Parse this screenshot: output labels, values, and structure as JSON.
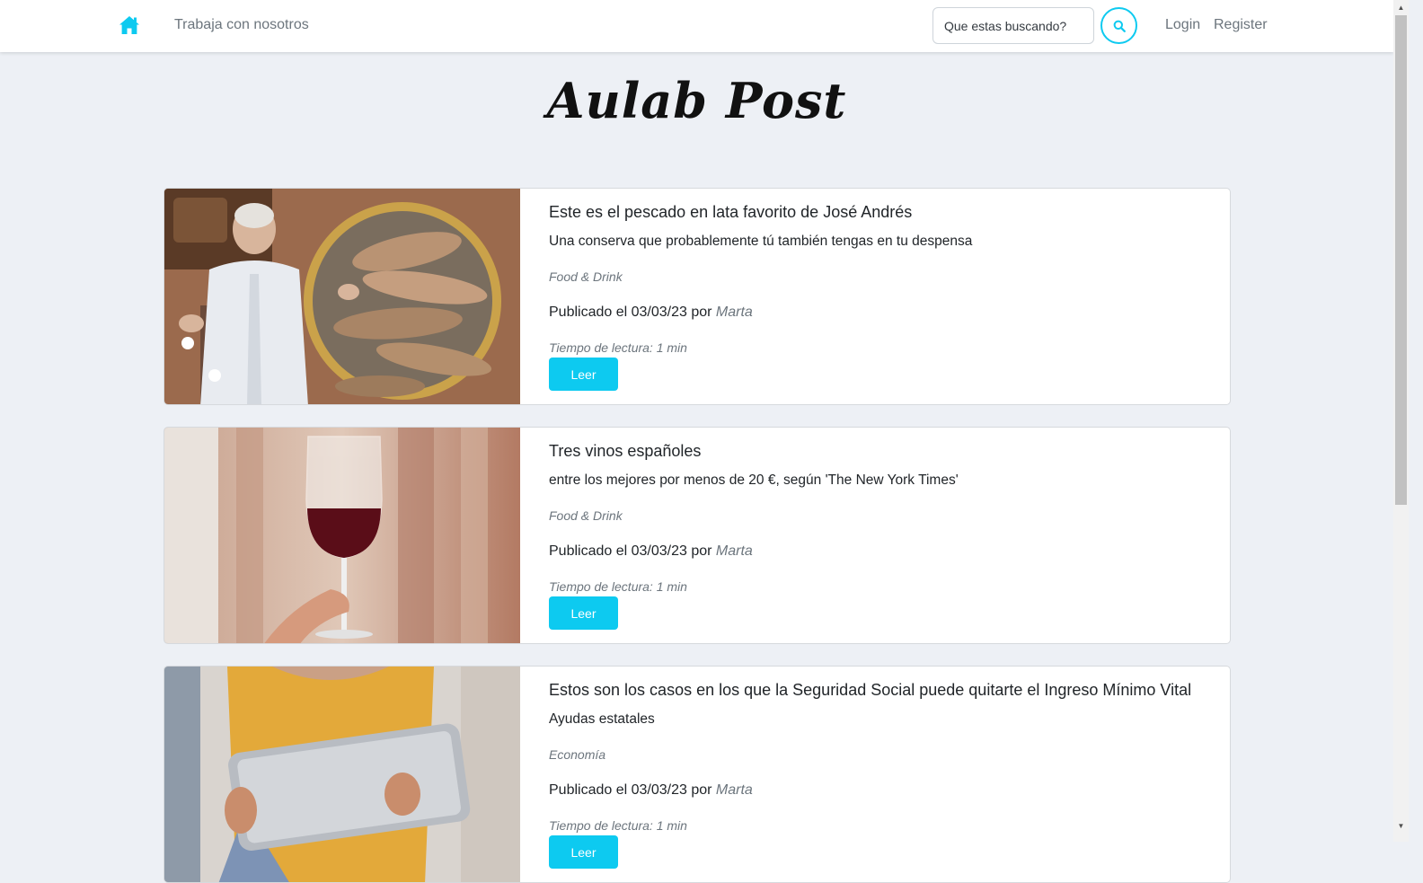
{
  "nav": {
    "home_icon": "home-icon",
    "work_with_us": "Trabaja con nosotros",
    "search_placeholder": "Que estas buscando?",
    "search_icon": "search-icon",
    "login": "Login",
    "register": "Register"
  },
  "page": {
    "title": "Aulab Post"
  },
  "colors": {
    "accent": "#0dcaf0",
    "background": "#edf0f5"
  },
  "articles": [
    {
      "title": "Este es el pescado en lata favorito de José Andrés",
      "subtitle": "Una conserva que probablemente tú también tengas en tu despensa",
      "category": "Food & Drink",
      "published_prefix": "Publicado el 03/03/23 por",
      "author": "Marta",
      "reading_time": "Tiempo de lectura: 1 min",
      "button": "Leer"
    },
    {
      "title": "Tres vinos españoles",
      "subtitle": "entre los mejores por menos de 20 €, según 'The New York Times'",
      "category": "Food & Drink",
      "published_prefix": "Publicado el 03/03/23 por",
      "author": "Marta",
      "reading_time": "Tiempo de lectura: 1 min",
      "button": "Leer"
    },
    {
      "title": "Estos son los casos en los que la Seguridad Social puede quitarte el Ingreso Mínimo Vital",
      "subtitle": "Ayudas estatales",
      "category": "Economía",
      "published_prefix": "Publicado el 03/03/23 por",
      "author": "Marta",
      "reading_time": "Tiempo de lectura: 1 min",
      "button": "Leer"
    }
  ]
}
